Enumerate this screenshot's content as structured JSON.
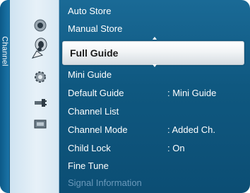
{
  "sidebar": {
    "tab_label": "Channel"
  },
  "menu": {
    "items_above": [
      {
        "label": "Auto Store"
      },
      {
        "label": "Manual Store"
      }
    ],
    "selected": {
      "label": "Full Guide"
    },
    "items_below": [
      {
        "label": "Mini Guide",
        "value": ""
      },
      {
        "label": "Default Guide",
        "value": ": Mini Guide"
      },
      {
        "label": "Channel List",
        "value": ""
      },
      {
        "label": "Channel Mode",
        "value": ": Added Ch."
      },
      {
        "label": "Child Lock",
        "value": ": On"
      },
      {
        "label": "Fine Tune",
        "value": ""
      },
      {
        "label": "Signal Information",
        "value": "",
        "disabled": true
      }
    ]
  },
  "icons": [
    "picture-icon",
    "sound-icon",
    "channel-icon",
    "setup-icon",
    "input-icon",
    "application-icon"
  ],
  "colors": {
    "background": "#0f5880",
    "icon_column": "#e0edf6",
    "highlight": "#f1f4f6",
    "disabled_text": "#6a99bb"
  }
}
